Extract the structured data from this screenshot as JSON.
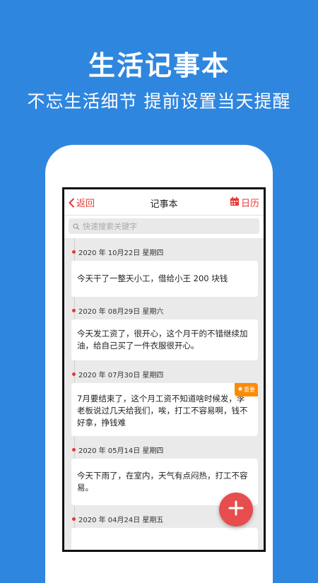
{
  "hero": {
    "title": "生活记事本",
    "subtitle": "不忘生活细节 提前设置当天提醒"
  },
  "nav": {
    "back_label": "返回",
    "title": "记事本",
    "calendar_label": "日历"
  },
  "search": {
    "placeholder": "快速搜索关键字"
  },
  "entries": [
    {
      "date": "2020 年 10月22日 星期四",
      "text": "今天干了一整天小工，借给小王 200 块钱",
      "badge": ""
    },
    {
      "date": "2020 年 08月29日 星期六",
      "text": "今天发工资了，很开心，这个月干的不错继续加油，给自己买了一件衣服很开心。",
      "badge": ""
    },
    {
      "date": "2020 年 07月30日 星期四",
      "text": "7月要结束了，这个月工资不知道啥时候发，李老板说过几天给我们，唉，打工不容易啊，钱不好拿，挣钱难",
      "badge": "重要"
    },
    {
      "date": "2020 年 05月14日 星期四",
      "text": "今天下雨了，在室内，天气有点闷热，打工不容易。",
      "badge": ""
    },
    {
      "date": "2020 年 04月24日 星期五",
      "text": "",
      "badge": ""
    }
  ],
  "colors": {
    "background": "#2f86df",
    "accent": "#e53935",
    "fab": "#e84d4d",
    "badge": "#ff8a00"
  },
  "icons": {
    "back": "chevron-left-icon",
    "calendar": "calendar-icon",
    "search": "search-icon",
    "fab": "plus-icon",
    "badge": "star-icon"
  }
}
